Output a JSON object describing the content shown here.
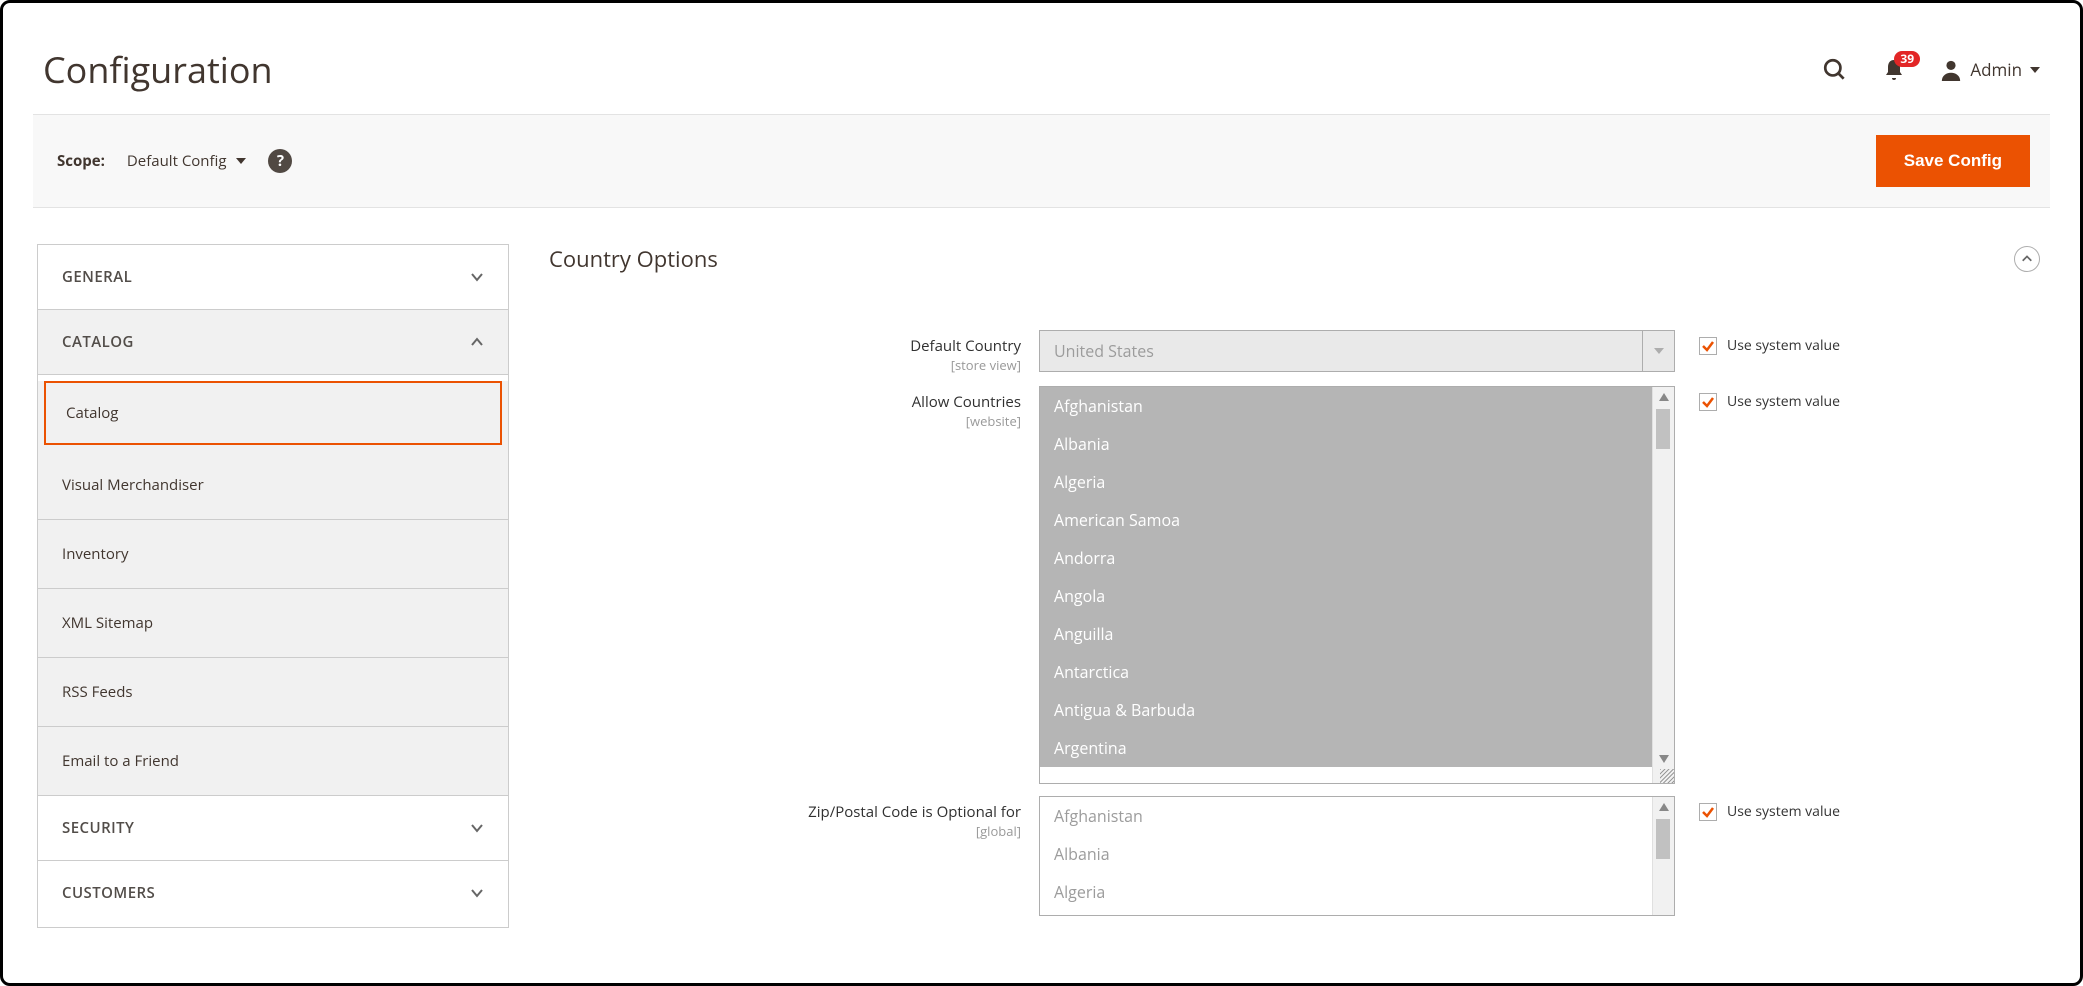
{
  "header": {
    "title": "Configuration",
    "notifications_count": "39",
    "admin_label": "Admin"
  },
  "scope": {
    "label": "Scope:",
    "value": "Default Config",
    "save_button": "Save Config"
  },
  "sidebar": {
    "tabs": [
      {
        "label": "GENERAL",
        "expanded": false
      },
      {
        "label": "CATALOG",
        "expanded": true,
        "items": [
          {
            "label": "Catalog",
            "active": true
          },
          {
            "label": "Visual Merchandiser"
          },
          {
            "label": "Inventory"
          },
          {
            "label": "XML Sitemap"
          },
          {
            "label": "RSS Feeds"
          },
          {
            "label": "Email to a Friend"
          }
        ]
      },
      {
        "label": "SECURITY",
        "expanded": false
      },
      {
        "label": "CUSTOMERS",
        "expanded": false
      }
    ]
  },
  "section": {
    "title": "Country Options",
    "fields": {
      "default_country": {
        "label": "Default Country",
        "scope": "[store view]",
        "value": "United States",
        "use_system_label": "Use system value"
      },
      "allow_countries": {
        "label": "Allow Countries",
        "scope": "[website]",
        "options": [
          "Afghanistan",
          "Albania",
          "Algeria",
          "American Samoa",
          "Andorra",
          "Angola",
          "Anguilla",
          "Antarctica",
          "Antigua & Barbuda",
          "Argentina"
        ],
        "use_system_label": "Use system value"
      },
      "zip_optional": {
        "label": "Zip/Postal Code is Optional for",
        "scope": "[global]",
        "options": [
          "Afghanistan",
          "Albania",
          "Algeria"
        ],
        "use_system_label": "Use system value"
      }
    }
  }
}
